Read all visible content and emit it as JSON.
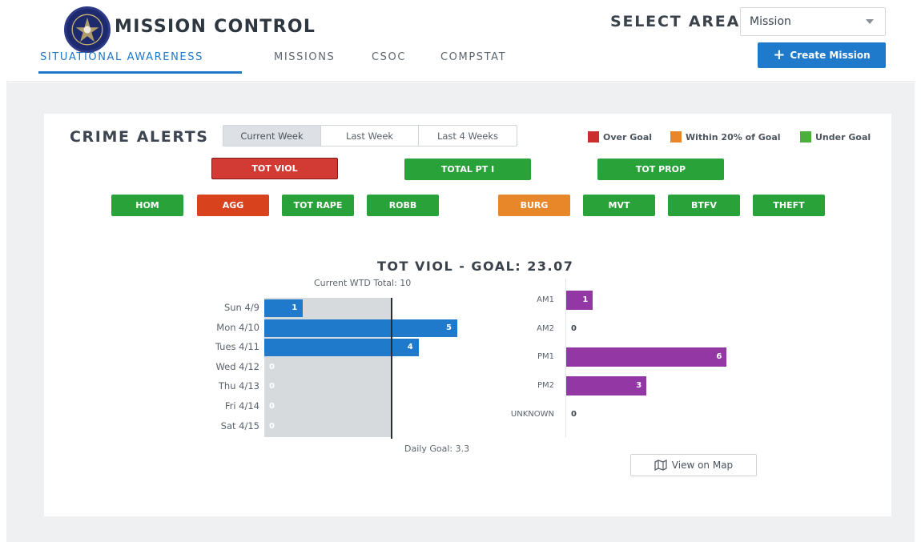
{
  "header": {
    "app_title": "MISSION CONTROL",
    "select_area_label": "SELECT AREA",
    "area_selected": "Mission",
    "create_label": "Create Mission",
    "nav_tabs": [
      "SITUATIONAL AWARENESS",
      "MISSIONS",
      "CSOC",
      "COMPSTAT"
    ],
    "active_tab": "SITUATIONAL AWARENESS"
  },
  "alerts": {
    "title": "CRIME ALERTS",
    "periods": [
      "Current Week",
      "Last Week",
      "Last 4 Weeks"
    ],
    "active_period": "Current Week",
    "legend": [
      {
        "label": "Over Goal",
        "color": "#cc2e2e"
      },
      {
        "label": "Within 20% of Goal",
        "color": "#e8862a"
      },
      {
        "label": "Under Goal",
        "color": "#4cae3c"
      }
    ],
    "summary_buttons": [
      {
        "label": "TOT VIOL",
        "status": "over",
        "color": "#d13b34"
      },
      {
        "label": "TOTAL PT I",
        "status": "under",
        "color": "#2aa23a"
      },
      {
        "label": "TOT PROP",
        "status": "under",
        "color": "#2aa23a"
      }
    ],
    "category_buttons": [
      {
        "label": "HOM",
        "status": "under",
        "color": "#2aa23a"
      },
      {
        "label": "AGG",
        "status": "over",
        "color": "#d8431e"
      },
      {
        "label": "TOT RAPE",
        "status": "under",
        "color": "#2aa23a"
      },
      {
        "label": "ROBB",
        "status": "under",
        "color": "#2aa23a"
      },
      {
        "label": "BURG",
        "status": "within",
        "color": "#e8862a"
      },
      {
        "label": "MVT",
        "status": "under",
        "color": "#2aa23a"
      },
      {
        "label": "BTFV",
        "status": "under",
        "color": "#2aa23a"
      },
      {
        "label": "THEFT",
        "status": "under",
        "color": "#2aa23a"
      }
    ]
  },
  "chart": {
    "title": "TOT VIOL - GOAL: 23.07",
    "wtd_total": "Current WTD Total: 10",
    "daily_goal_label": "Daily Goal: 3.3",
    "map_button": "View on Map"
  },
  "chart_data": [
    {
      "type": "bar",
      "orientation": "horizontal",
      "categories": [
        "Sun 4/9",
        "Mon 4/10",
        "Tues 4/11",
        "Wed 4/12",
        "Thu 4/13",
        "Fri 4/14",
        "Sat 4/15"
      ],
      "values": [
        1,
        5,
        4,
        0,
        0,
        0,
        0
      ],
      "goal_line": 3.3,
      "xlim": [
        0,
        8
      ],
      "bar_color": "#1f7acc"
    },
    {
      "type": "bar",
      "orientation": "horizontal",
      "categories": [
        "AM1",
        "AM2",
        "PM1",
        "PM2",
        "UNKNOWN"
      ],
      "values": [
        1,
        0,
        6,
        3,
        0
      ],
      "xlim": [
        0,
        7
      ],
      "bar_color": "#9237a3"
    }
  ]
}
